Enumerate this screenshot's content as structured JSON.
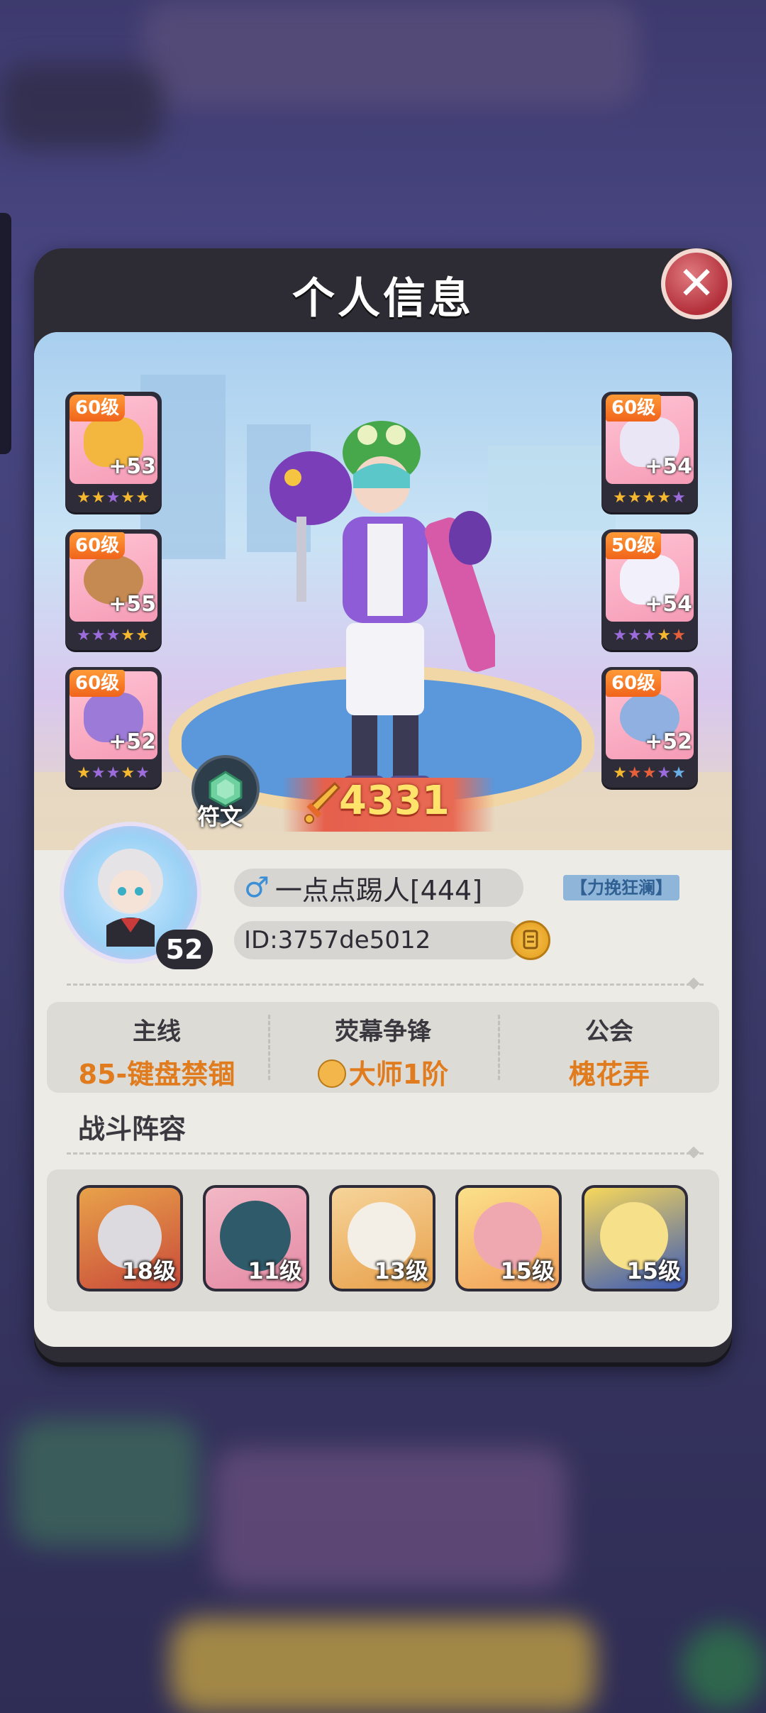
{
  "modal": {
    "title": "个人信息",
    "close_icon": "close-icon"
  },
  "equipment": {
    "left": [
      {
        "level": "60级",
        "plus": "+53",
        "item": "helmet",
        "stars": [
          "#f5b82e",
          "#f5b82e",
          "#9c6bdc",
          "#f5b82e",
          "#f5b82e"
        ]
      },
      {
        "level": "60级",
        "plus": "+55",
        "item": "bracer",
        "stars": [
          "#9c6bdc",
          "#9c6bdc",
          "#9c6bdc",
          "#f5b82e",
          "#f5b82e"
        ]
      },
      {
        "level": "60级",
        "plus": "+52",
        "item": "boots",
        "stars": [
          "#f5b82e",
          "#9c6bdc",
          "#9c6bdc",
          "#f5b82e",
          "#9c6bdc"
        ]
      }
    ],
    "right": [
      {
        "level": "60级",
        "plus": "+54",
        "item": "jacket",
        "stars": [
          "#f5b82e",
          "#f5b82e",
          "#f5b82e",
          "#f5b82e",
          "#9c6bdc"
        ]
      },
      {
        "level": "50级",
        "plus": "+54",
        "item": "shorts",
        "stars": [
          "#9c6bdc",
          "#9c6bdc",
          "#9c6bdc",
          "#f5b82e",
          "#e8603a"
        ]
      },
      {
        "level": "60级",
        "plus": "+52",
        "item": "gadget",
        "stars": [
          "#f5b82e",
          "#e8603a",
          "#e8603a",
          "#9c6bdc",
          "#6ab0e8"
        ]
      }
    ]
  },
  "rune": {
    "label": "符文",
    "icon": "rune-gem-icon"
  },
  "power": {
    "value": "4331",
    "icon": "sword-icon"
  },
  "player": {
    "avatar_level": "52",
    "gender_symbol": "♂",
    "name": "一点点踢人[444]",
    "title_tag": "【力挽狂澜】",
    "id": "ID:3757de5012",
    "copy_icon": "copy-icon"
  },
  "stats": {
    "mainline": {
      "label": "主线",
      "value": "85-键盘禁锢"
    },
    "arena": {
      "label": "荧幕争锋",
      "value": "大师1阶"
    },
    "guild": {
      "label": "公会",
      "value": "槐花弄"
    }
  },
  "team": {
    "title": "战斗阵容",
    "members": [
      {
        "level": "18级"
      },
      {
        "level": "11级"
      },
      {
        "level": "13级"
      },
      {
        "level": "15级"
      },
      {
        "level": "15级"
      }
    ]
  },
  "colors": {
    "accent_orange": "#e07b1e",
    "level_badge": "#f0641b",
    "close_red": "#b3303a",
    "power_text": "#ffe36b"
  }
}
